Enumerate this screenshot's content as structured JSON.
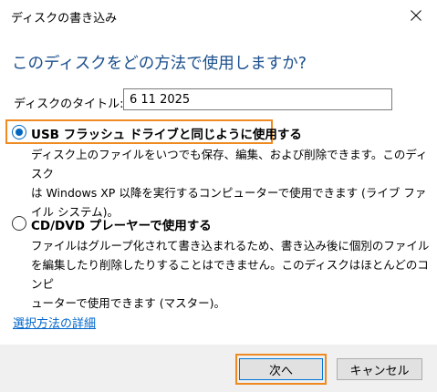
{
  "window": {
    "title": "ディスクの書き込み",
    "close_icon": "close-icon"
  },
  "heading": "このディスクをどの方法で使用しますか?",
  "disc_title": {
    "label": "ディスクのタイトル:",
    "value": "6 11 2025"
  },
  "options": [
    {
      "label": "USB フラッシュ ドライブと同じように使用する",
      "selected": true,
      "description": [
        "ディスク上のファイルをいつでも保存、編集、および削除できます。このディスク",
        "は Windows XP 以降を実行するコンピューターで使用できます (ライブ ファ",
        "イル システム)。"
      ]
    },
    {
      "label": "CD/DVD プレーヤーで使用する",
      "selected": false,
      "description": [
        "ファイルはグループ化されて書き込まれるため、書き込み後に個別のファイル",
        "を編集したり削除したりすることはできません。このディスクはほとんどのコンピ",
        "ューターで使用できます (マスター)。"
      ]
    }
  ],
  "details_link": "選択方法の詳細",
  "buttons": {
    "next": "次へ",
    "cancel": "キャンセル"
  },
  "colors": {
    "heading": "#1b4f8c",
    "highlight": "#ee8a21",
    "radio_accent": "#0067c0",
    "link": "#0066cc",
    "footer_bg": "#f0f0f0"
  }
}
